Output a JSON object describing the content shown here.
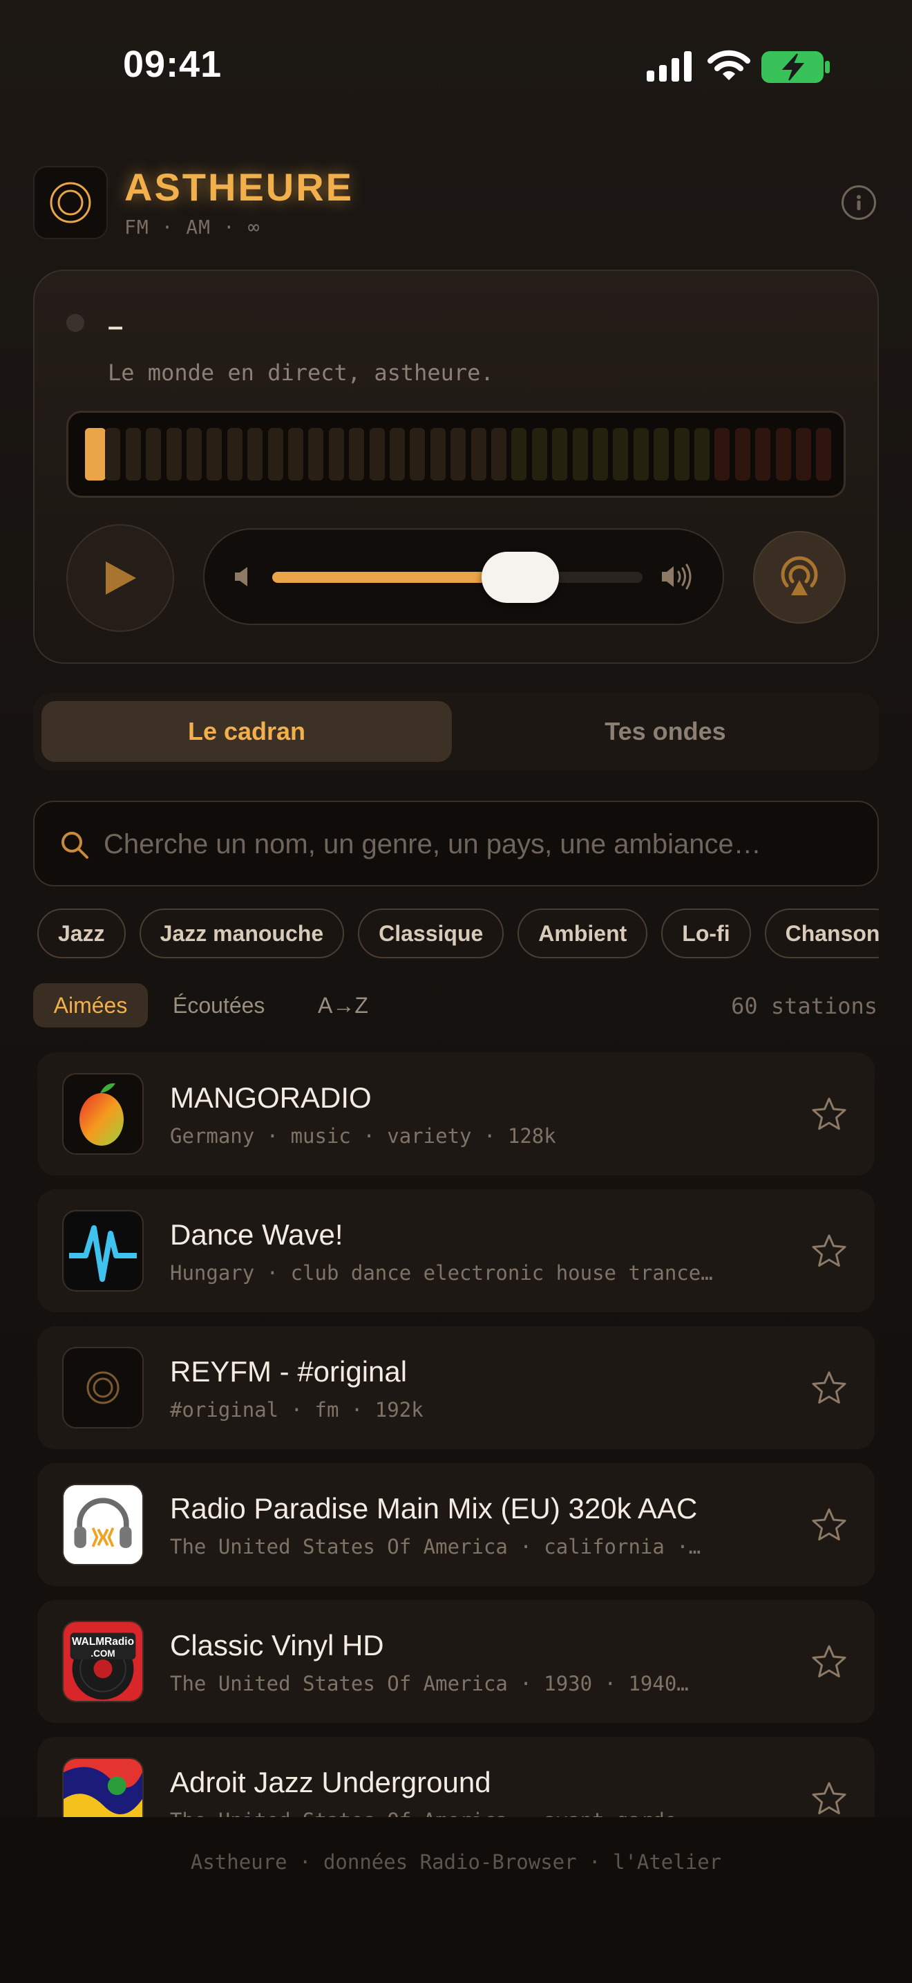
{
  "status_bar": {
    "time": "09:41"
  },
  "header": {
    "title": "ASTHEURE",
    "subtitle": "FM · AM · ∞"
  },
  "player": {
    "station_name": "–",
    "tagline": "Le monde en direct, astheure.",
    "volume_level": 0.67,
    "colors": {
      "accent": "#e9a547",
      "meter_green": "#3a3a18",
      "meter_red": "#3a1a12"
    }
  },
  "tabs": {
    "dial": "Le cadran",
    "mine": "Tes ondes"
  },
  "search": {
    "placeholder": "Cherche un nom, un genre, un pays, une ambiance…"
  },
  "chips": [
    "Jazz",
    "Jazz manouche",
    "Classique",
    "Ambient",
    "Lo-fi",
    "Chanson"
  ],
  "sort": {
    "loved": "Aimées",
    "played": "Écoutées",
    "az": "A→Z",
    "count": "60 stations"
  },
  "stations": [
    {
      "name": "MANGORADIO",
      "meta": "Germany  ·  music · variety  ·  128k",
      "icon": "mango-logo"
    },
    {
      "name": "Dance Wave!",
      "meta": "Hungary  ·  club dance electronic house trance…",
      "icon": "wave-logo"
    },
    {
      "name": "REYFM - #original",
      "meta": "#original · fm  ·  192k",
      "icon": "dial-logo"
    },
    {
      "name": "Radio Paradise Main Mix (EU) 320k AAC",
      "meta": "The United States Of America  ·  california ·…",
      "icon": "headphones-logo"
    },
    {
      "name": "Classic Vinyl HD",
      "meta": "The United States Of America  ·  1930 · 1940…",
      "icon": "vinyl-logo"
    },
    {
      "name": "Adroit Jazz Underground",
      "meta": "The United States Of America  ·  avant-garde…",
      "icon": "abstract-logo"
    }
  ],
  "footer": "Astheure · données Radio-Browser · l'Atelier"
}
